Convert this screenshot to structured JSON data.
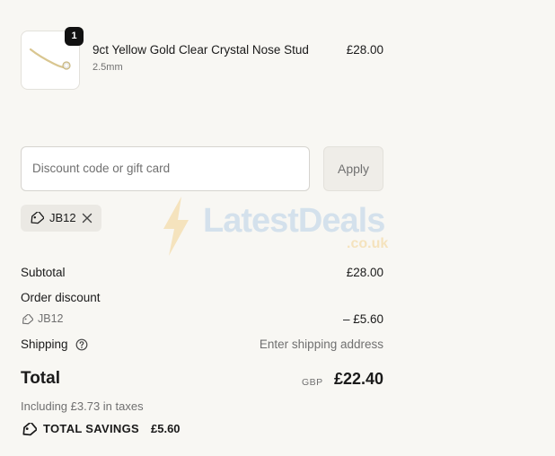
{
  "product": {
    "quantity": "1",
    "name": "9ct Yellow Gold Clear Crystal Nose Stud",
    "variant": "2.5mm",
    "price": "£28.00",
    "image_icon": "nose-stud-image"
  },
  "discount": {
    "placeholder": "Discount code or gift card",
    "apply_label": "Apply",
    "applied_code": "JB12"
  },
  "watermark": {
    "brand": "LatestDeals",
    "domain": ".co.uk"
  },
  "summary": {
    "subtotal_label": "Subtotal",
    "subtotal_value": "£28.00",
    "order_discount_label": "Order discount",
    "discount_code": "JB12",
    "discount_value": "– £5.60",
    "shipping_label": "Shipping",
    "shipping_value": "Enter shipping address",
    "total_label": "Total",
    "currency": "GBP",
    "total_value": "£22.40",
    "taxes_note": "Including £3.73 in taxes",
    "savings_label": "TOTAL SAVINGS",
    "savings_value": "£5.60"
  },
  "colors": {
    "background": "#f8f7f3",
    "text": "#1a1a1a",
    "muted": "#707070",
    "badge": "#111111"
  }
}
